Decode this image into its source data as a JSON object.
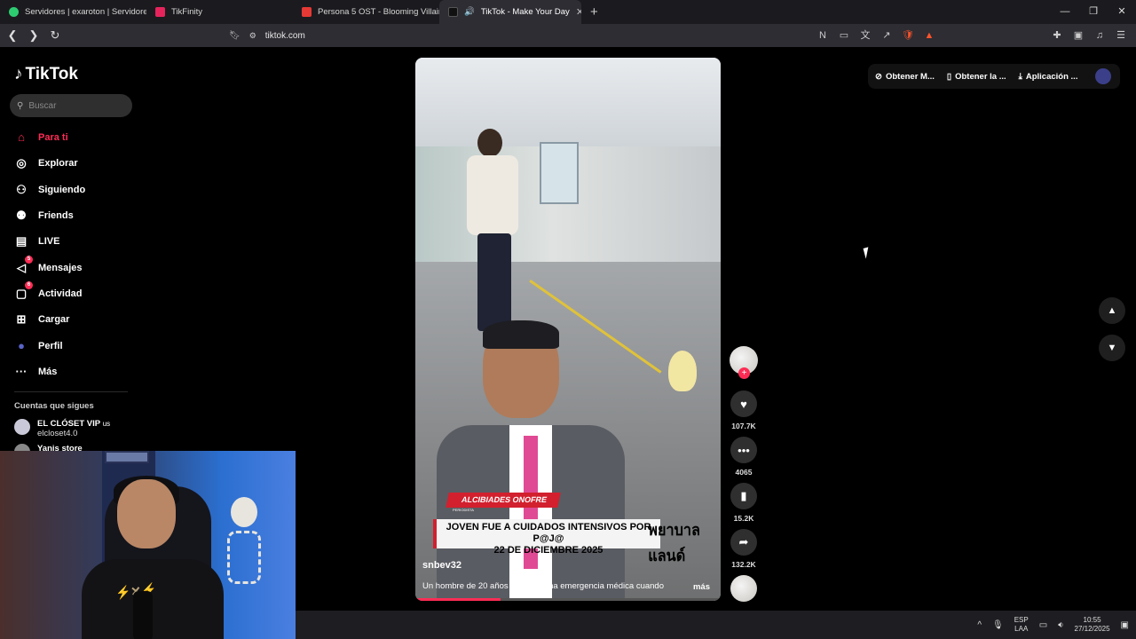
{
  "browser": {
    "tabs": [
      {
        "title": "Servidores | exaroton | Servidores de",
        "color": "#2ecc71"
      },
      {
        "title": "TikFinity",
        "color": "#e5245c"
      },
      {
        "title": "Persona 5 OST - Blooming Villain [Ext",
        "color": "#e53935"
      },
      {
        "title": "TikTok - Make Your Day",
        "color": "#111111"
      }
    ],
    "new_tab": "+",
    "url": "tiktok.com"
  },
  "tiktok": {
    "logo": "TikTok",
    "search_placeholder": "Buscar",
    "nav": [
      {
        "label": "Para ti",
        "icon": "home-icon",
        "active": true
      },
      {
        "label": "Explorar",
        "icon": "compass-icon"
      },
      {
        "label": "Siguiendo",
        "icon": "following-icon"
      },
      {
        "label": "Friends",
        "icon": "friends-icon"
      },
      {
        "label": "LIVE",
        "icon": "live-icon"
      },
      {
        "label": "Mensajes",
        "icon": "messages-icon",
        "badge": "5"
      },
      {
        "label": "Actividad",
        "icon": "activity-icon",
        "badge": "6"
      },
      {
        "label": "Cargar",
        "icon": "upload-icon"
      },
      {
        "label": "Perfil",
        "icon": "profile-icon"
      },
      {
        "label": "Más",
        "icon": "more-icon"
      }
    ],
    "following_title": "Cuentas que sigues",
    "accounts": [
      {
        "name": "EL CLÓSET VIP",
        "flag": "us",
        "handle": "elcloset4.0"
      },
      {
        "name": "Yanis store",
        "handle": ""
      }
    ],
    "top_actions": [
      {
        "label": "Obtener M...",
        "icon": "coin-icon"
      },
      {
        "label": "Obtener la ...",
        "icon": "phone-icon"
      },
      {
        "label": "Aplicación ...",
        "icon": "download-icon"
      }
    ],
    "video": {
      "username": "snbev32",
      "description": "Un hombre de 20 años enfrentó una emergencia médica cuando",
      "more": "más",
      "overlay_name": "ALCIBIADES ONOFRE",
      "overlay_sub": "PERIODISTA",
      "overlay_headline_1": "JOVEN FUE A CUIDADOS INTENSIVOS POR P@J@",
      "overlay_headline_2": "22 DE DICIEMBRE 2025",
      "overlay_foreign": "พยาบาลแลนด์",
      "progress": 0.28
    },
    "stats": {
      "likes": "107.7K",
      "comments": "4065",
      "saves": "15.2K",
      "shares": "132.2K"
    }
  },
  "taskbar": {
    "lang_1": "ESP",
    "lang_2": "LAA",
    "time": "10:55",
    "date": "27/12/2025"
  },
  "colors": {
    "accent": "#fe2c55",
    "background": "#000000"
  }
}
